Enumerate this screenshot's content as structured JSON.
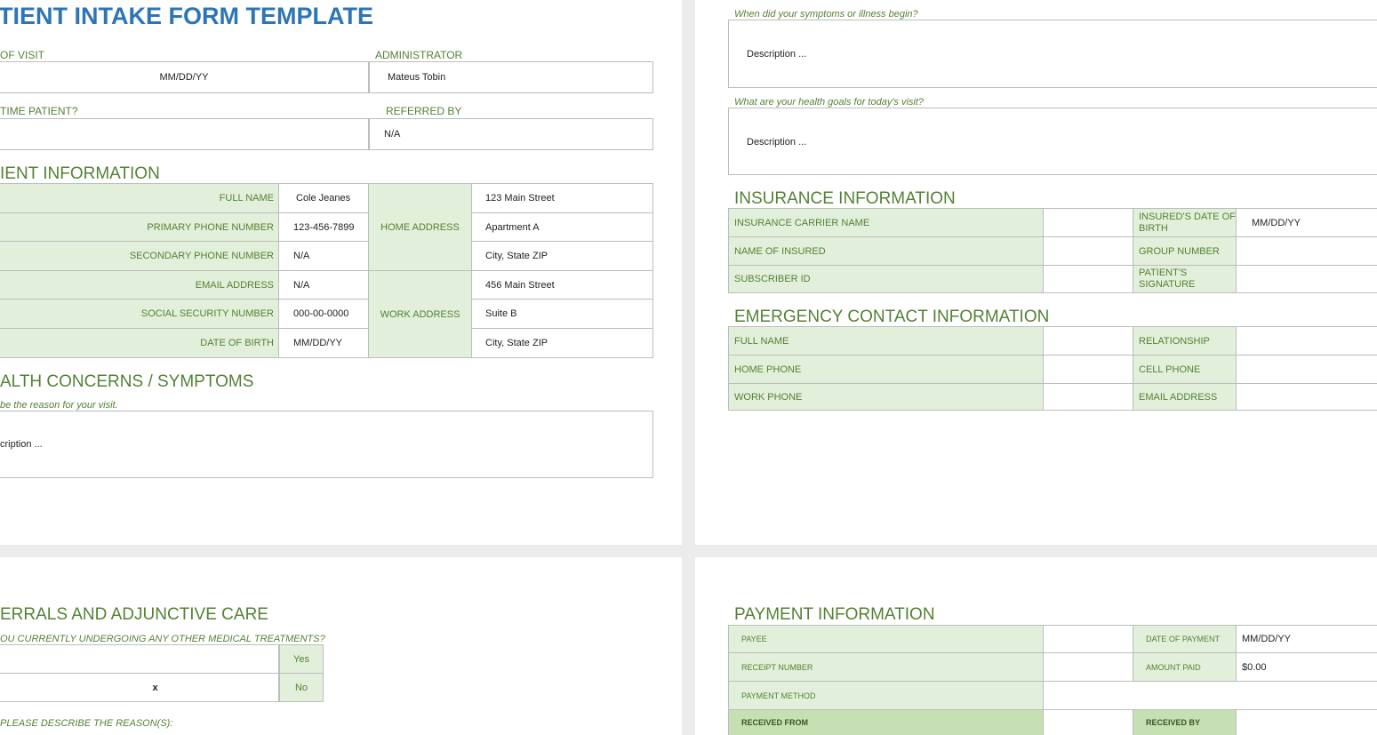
{
  "form_title": "TIENT INTAKE FORM TEMPLATE",
  "visit": {
    "date_label": "OF VISIT",
    "date_value": "MM/DD/YY",
    "admin_label": "ADMINISTRATOR",
    "admin_value": "Mateus Tobin",
    "first_time_label": "TIME PATIENT?",
    "first_time_value": "",
    "referred_label": "REFERRED BY",
    "referred_value": "N/A"
  },
  "patient_info": {
    "heading": "IENT INFORMATION",
    "rows": [
      {
        "label": "FULL NAME",
        "value": "Cole Jeanes"
      },
      {
        "label": "PRIMARY PHONE NUMBER",
        "value": "123-456-7899"
      },
      {
        "label": "SECONDARY PHONE NUMBER",
        "value": "N/A"
      },
      {
        "label": "EMAIL ADDRESS",
        "value": "N/A"
      },
      {
        "label": "SOCIAL SECURITY NUMBER",
        "value": "000-00-0000"
      },
      {
        "label": "DATE OF BIRTH",
        "value": "MM/DD/YY"
      }
    ],
    "home_address_label": "HOME ADDRESS",
    "home_address": [
      "123 Main Street",
      "Apartment A",
      "City, State ZIP"
    ],
    "work_address_label": "WORK ADDRESS",
    "work_address": [
      "456 Main Street",
      "Suite B",
      "City, State ZIP"
    ]
  },
  "health": {
    "heading": "ALTH CONCERNS / SYMPTOMS",
    "question": "be the reason for your visit.",
    "answer": "cription ...",
    "symptoms_question": "When did your symptoms or illness begin?",
    "symptoms_answer": "Description ...",
    "goals_question": "What are your health goals for today's visit?",
    "goals_answer": "Description ..."
  },
  "insurance": {
    "heading": "INSURANCE INFORMATION",
    "left_labels": [
      "INSURANCE CARRIER NAME",
      "NAME OF INSURED",
      "SUBSCRIBER ID"
    ],
    "left_values": [
      "",
      "",
      ""
    ],
    "right_labels": [
      "INSURED'S DATE OF BIRTH",
      "GROUP NUMBER",
      "PATIENT'S SIGNATURE"
    ],
    "right_values": [
      "MM/DD/YY",
      "",
      ""
    ]
  },
  "emergency": {
    "heading": "EMERGENCY CONTACT INFORMATION",
    "left_labels": [
      "FULL NAME",
      "HOME PHONE",
      "WORK PHONE"
    ],
    "left_values": [
      "",
      "",
      ""
    ],
    "right_labels": [
      "RELATIONSHIP",
      "CELL PHONE",
      "EMAIL ADDRESS"
    ],
    "right_values": [
      "",
      "",
      ""
    ]
  },
  "referrals": {
    "heading": "ERRALS AND ADJUNCTIVE CARE",
    "question": "OU CURRENTLY UNDERGOING ANY OTHER MEDICAL TREATMENTS?",
    "yes_label": "Yes",
    "no_label": "No",
    "yes_mark": "",
    "no_mark": "x",
    "reason_label": "PLEASE DESCRIBE THE REASON(S):"
  },
  "payment": {
    "heading": "PAYMENT INFORMATION",
    "payee_label": "PAYEE",
    "receipt_label": "RECEIPT NUMBER",
    "method_label": "PAYMENT METHOD",
    "received_from_label": "RECEIVED FROM",
    "date_label": "DATE OF PAYMENT",
    "date_value": "MM/DD/YY",
    "amount_label": "AMOUNT PAID",
    "amount_value": "$0.00",
    "received_by_label": "RECEIVED BY"
  },
  "colors": {
    "title_blue": "#2e75b6",
    "section_green": "#548235",
    "cell_green": "#e2efda",
    "border": "#bdbdbd"
  }
}
